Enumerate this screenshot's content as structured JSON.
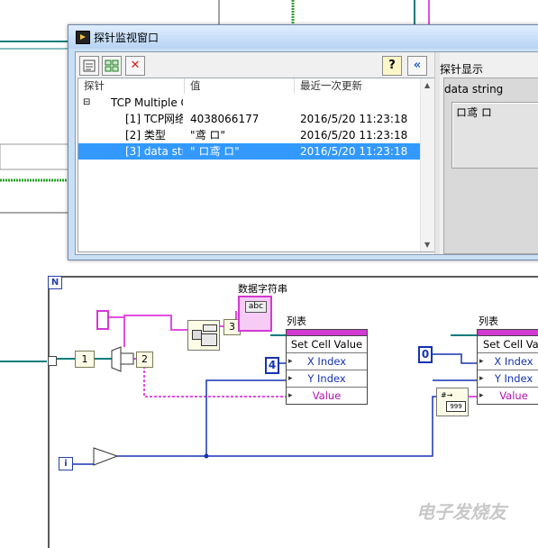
{
  "probe_window": {
    "title": "探针监视窗口",
    "side_label": "探针显示",
    "columns": [
      "探针",
      "值",
      "最近一次更新"
    ],
    "tree": {
      "root": "TCP Multiple C",
      "rows": [
        {
          "name": "[1] TCP网络",
          "value": "4038066177",
          "updated": "2016/5/20 11:23:18",
          "selected": false
        },
        {
          "name": "[2] 类型",
          "value": "\"鸢 ロ\"",
          "updated": "2016/5/20 11:23:18",
          "selected": false
        },
        {
          "name": "[3] data str",
          "value": "\"   ロ鸢 ロ\"",
          "updated": "2016/5/20 11:23:18",
          "selected": true
        }
      ]
    },
    "display": {
      "title": "data string",
      "value": "ロ鸢 ロ"
    },
    "toolbar_icons": [
      "new-probe-icon",
      "add-probe-icon",
      "delete-probe-icon",
      "help-icon",
      "collapse-icon"
    ]
  },
  "diagram": {
    "loop_label": "N",
    "iteration_label": "i",
    "index_1": "1",
    "index_2": "2",
    "index_3": "3",
    "data_string_label": "数据字符串",
    "list_label_1": "列表",
    "list_label_2": "列表",
    "const_4": "4",
    "const_0": "0",
    "property_node_1": {
      "rows": [
        "Set Cell Value",
        "X Index",
        "Y Index",
        "Value"
      ]
    },
    "property_node_2": {
      "rows": [
        "Set Cell Va",
        "X Index",
        "Y Index",
        "Value"
      ]
    },
    "string_indicator": "abc",
    "colors": {
      "wire_int": "#1633b3",
      "wire_string": "#e24ee2",
      "wire_cluster": "#087c7c",
      "wire_green": "#2aa02a"
    }
  },
  "watermark": "电子发烧友"
}
